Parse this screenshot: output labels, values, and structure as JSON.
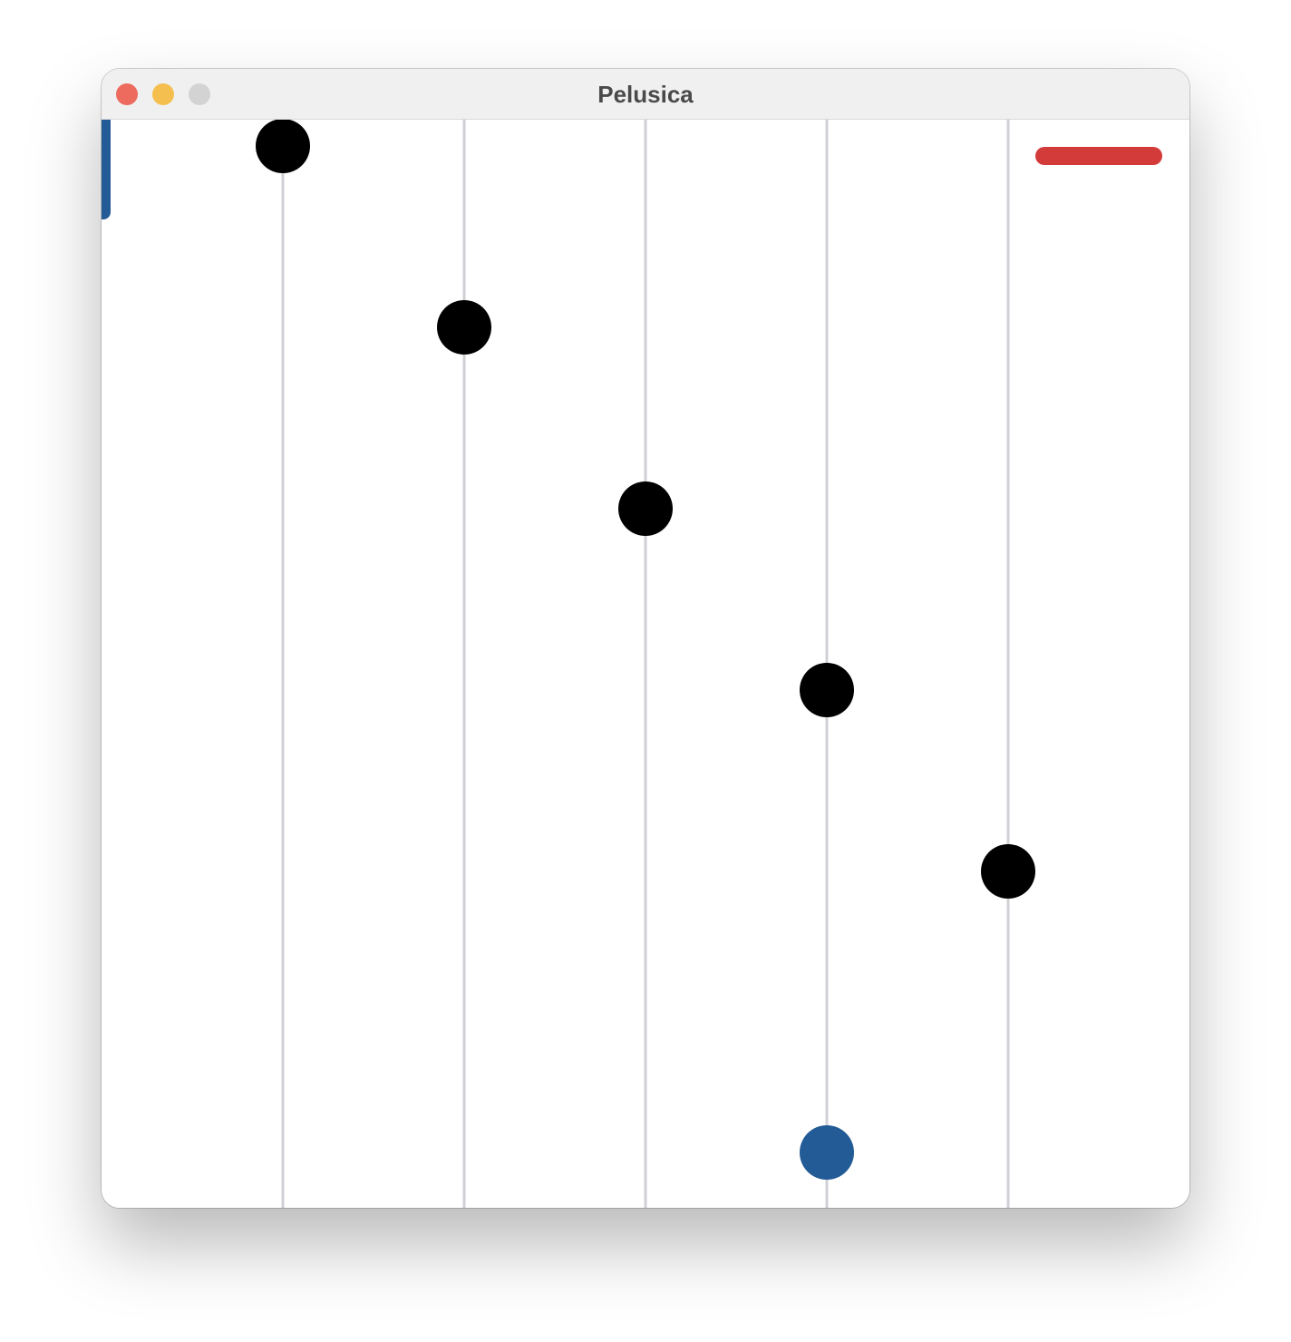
{
  "window": {
    "title": "Pelusica"
  },
  "colors": {
    "close": "#ec6a5e",
    "minimize": "#f5bf4f",
    "zoom": "#d3d3d3",
    "track_line": "#d0cfd6",
    "obstacle": "#000000",
    "player": "#225b95",
    "bar": "#d33b3b",
    "indicator": "#225b95"
  },
  "game": {
    "lanes": 5,
    "obstacles": [
      {
        "lane": 1,
        "row": 6
      },
      {
        "lane": 2,
        "row": 5
      },
      {
        "lane": 3,
        "row": 4
      },
      {
        "lane": 4,
        "row": 3
      },
      {
        "lane": 5,
        "row": 2
      }
    ],
    "player": {
      "lane": 4
    },
    "bar_fill": 1.0
  }
}
